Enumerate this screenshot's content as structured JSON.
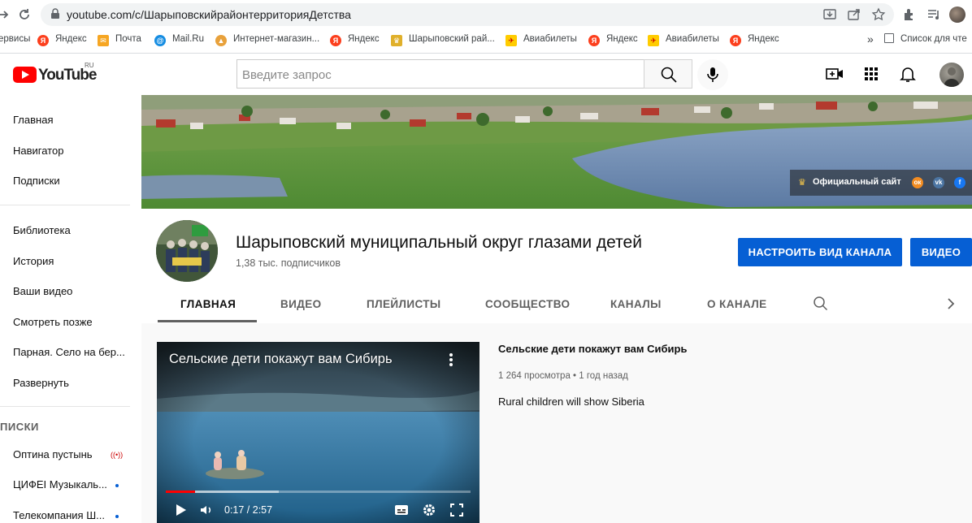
{
  "browser": {
    "url": "youtube.com/c/ШарыповскийрайонтерриторияДетства",
    "bookmarks": [
      {
        "label": "ервисы",
        "icon": "apps-icon",
        "color": "#5f6368"
      },
      {
        "label": "Яндекс",
        "icon": "yandex-icon",
        "color": "#fc3f1d"
      },
      {
        "label": "Почта",
        "icon": "mail-icon",
        "color": "#f6a623"
      },
      {
        "label": "Mail.Ru",
        "icon": "mailru-icon",
        "color": "#168de2"
      },
      {
        "label": "Интернет-магазин...",
        "icon": "shop-icon",
        "color": "#e8a13b"
      },
      {
        "label": "Яндекс",
        "icon": "yandex-icon",
        "color": "#fc3f1d"
      },
      {
        "label": "Шарыповский рай...",
        "icon": "emblem-icon",
        "color": "#e0b02b"
      },
      {
        "label": "Авиабилеты",
        "icon": "tickets-icon",
        "color": "#ffcc00"
      },
      {
        "label": "Яндекс",
        "icon": "yandex-icon",
        "color": "#fc3f1d"
      },
      {
        "label": "Авиабилеты",
        "icon": "tickets-icon",
        "color": "#ffcc00"
      },
      {
        "label": "Яндекс",
        "icon": "yandex-icon",
        "color": "#fc3f1d"
      }
    ],
    "more_label": "»",
    "reading_list": "Список для чте"
  },
  "yt": {
    "logo_word": "YouTube",
    "logo_region": "RU",
    "search_placeholder": "Введите запрос",
    "accent": "#ff0000",
    "blue": "#065fd4"
  },
  "sidebar": {
    "items": [
      "Главная",
      "Навигатор",
      "Подписки"
    ],
    "library": [
      "Библиотека",
      "История",
      "Ваши видео",
      "Смотреть позже",
      "Парная. Село на бер...",
      "Развернуть"
    ],
    "subs_heading": "ПИСКИ",
    "subs": [
      "Оптина пустынь",
      "ЦИФЕI Музыкаль...",
      "Телекомпания Ш..."
    ]
  },
  "banner": {
    "official_site": "Официальный сайт"
  },
  "channel": {
    "title": "Шарыповский муниципальный округ глазами детей",
    "subscribers": "1,38 тыс. подписчиков",
    "customize_button": "НАСТРОИТЬ ВИД КАНАЛА",
    "video_button": "ВИДЕО",
    "tabs": [
      "ГЛАВНАЯ",
      "ВИДЕО",
      "ПЛЕЙЛИСТЫ",
      "СООБЩЕСТВО",
      "КАНАЛЫ",
      "О КАНАЛЕ"
    ]
  },
  "featured": {
    "player_title": "Сельские дети покажут вам Сибирь",
    "time": "0:17 / 2:57",
    "progress_fraction": 0.096,
    "buffer_fraction": 0.37,
    "title": "Сельские дети покажут вам Сибирь",
    "meta": "1 264 просмотра • 1 год назад",
    "description": "Rural children will show Siberia"
  }
}
